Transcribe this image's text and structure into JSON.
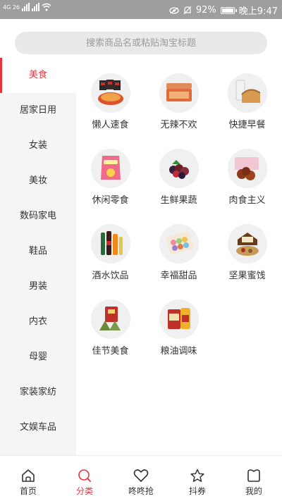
{
  "status": {
    "net": "4G 26",
    "battery": "92%",
    "battery_level": 0.92,
    "time": "晚上9:47"
  },
  "search": {
    "placeholder": "搜索商品名或粘贴淘宝标题"
  },
  "sidebar": {
    "items": [
      {
        "label": "美食",
        "active": true
      },
      {
        "label": "居家日用"
      },
      {
        "label": "女装"
      },
      {
        "label": "美妆"
      },
      {
        "label": "数码家电"
      },
      {
        "label": "鞋品"
      },
      {
        "label": "男装"
      },
      {
        "label": "内衣"
      },
      {
        "label": "母婴"
      },
      {
        "label": "家装家纺"
      },
      {
        "label": "文娱车品"
      }
    ]
  },
  "categories": [
    {
      "label": "懒人速食",
      "icon": "instant-noodles-icon"
    },
    {
      "label": "无辣不欢",
      "icon": "spicy-snack-icon"
    },
    {
      "label": "快捷早餐",
      "icon": "bread-milk-icon"
    },
    {
      "label": "休闲零食",
      "icon": "chips-bag-icon"
    },
    {
      "label": "生鲜果蔬",
      "icon": "fruit-icon"
    },
    {
      "label": "肉食主义",
      "icon": "meat-icon"
    },
    {
      "label": "酒水饮品",
      "icon": "drinks-icon"
    },
    {
      "label": "幸福甜品",
      "icon": "macaron-icon"
    },
    {
      "label": "坚果蜜饯",
      "icon": "nuts-icon"
    },
    {
      "label": "佳节美食",
      "icon": "zongzi-icon"
    },
    {
      "label": "粮油调味",
      "icon": "rice-oil-icon"
    }
  ],
  "tabs": [
    {
      "label": "首页",
      "icon": "home-icon"
    },
    {
      "label": "分类",
      "icon": "category-icon",
      "active": true
    },
    {
      "label": "咚咚抢",
      "icon": "heart-icon"
    },
    {
      "label": "抖券",
      "icon": "star-icon"
    },
    {
      "label": "我的",
      "icon": "profile-icon"
    }
  ],
  "colors": {
    "accent": "#e8343e",
    "sidebar_bg": "#f5f5f5",
    "statusbar_bg": "#9e9e9e"
  }
}
